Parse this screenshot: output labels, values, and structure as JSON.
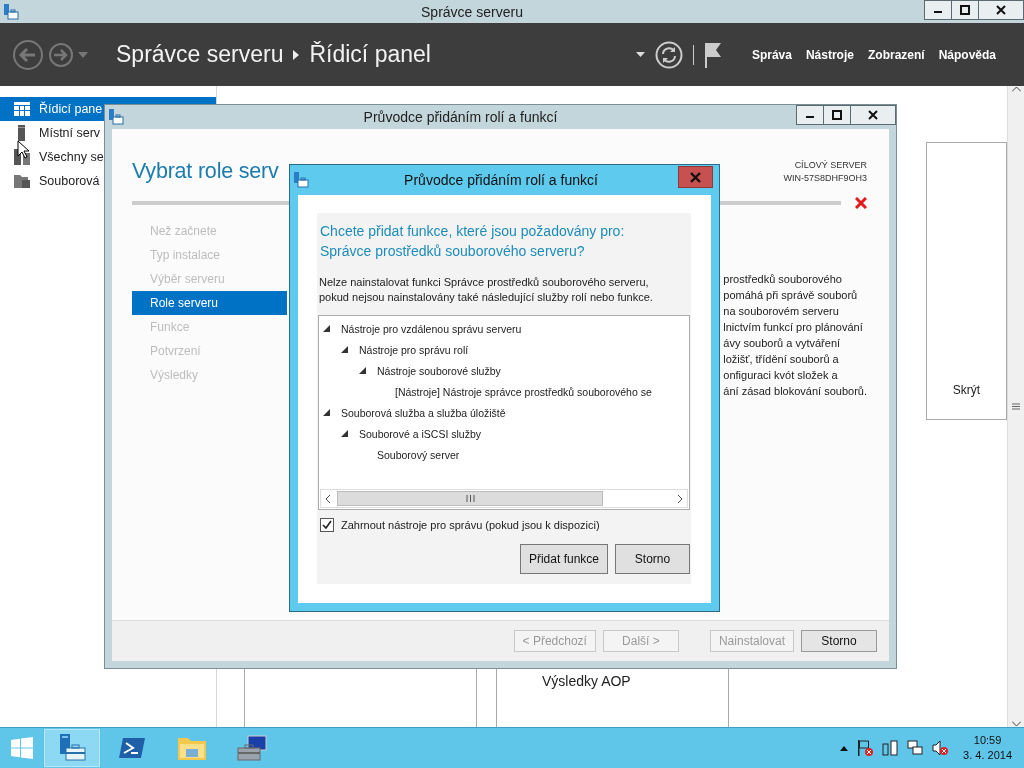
{
  "window": {
    "title": "Správce serveru",
    "breadcrumb": [
      "Správce serveru",
      "Řídicí panel"
    ],
    "menu": [
      "Správa",
      "Nástroje",
      "Zobrazení",
      "Nápověda"
    ]
  },
  "sidebar": {
    "items": [
      {
        "label": "Řídicí pane",
        "kind": "dashboard",
        "selected": true
      },
      {
        "label": "Místní serv",
        "kind": "local",
        "selected": false
      },
      {
        "label": "Všechny se",
        "kind": "all",
        "selected": false
      },
      {
        "label": "Souborová",
        "kind": "files",
        "selected": false
      }
    ]
  },
  "dashboard": {
    "hide_link": "Skrýt",
    "tile_title": "Výsledky AOP"
  },
  "wizard": {
    "title": "Průvodce přidáním rolí a funkcí",
    "heading": "Vybrat role serv",
    "target_label": "CÍLOVÝ SERVER",
    "target_server": "WIN-57S8DHF9OH3",
    "steps": [
      {
        "label": "Než začnete",
        "selected": false
      },
      {
        "label": "Typ instalace",
        "selected": false
      },
      {
        "label": "Výběr serveru",
        "selected": false
      },
      {
        "label": "Role serveru",
        "selected": true
      },
      {
        "label": "Funkce",
        "selected": false
      },
      {
        "label": "Potvrzení",
        "selected": false
      },
      {
        "label": "Výsledky",
        "selected": false
      }
    ],
    "description_lines": [
      "prostředků souborového",
      "pomáhá při správě souborů",
      "na souborovém serveru",
      "lnictvím funkcí pro plánování",
      "ávy souborů a vytváření",
      "ložišť, třídění souborů a",
      "onfiguraci kvót složek a",
      "ání zásad blokování souborů."
    ],
    "buttons": [
      {
        "label": "< Předchozí",
        "disabled": true
      },
      {
        "label": "Další >",
        "disabled": true
      },
      {
        "label": "Nainstalovat",
        "disabled": true
      },
      {
        "label": "Storno",
        "disabled": false
      }
    ]
  },
  "dialog": {
    "title": "Průvodce přidáním rolí a funkcí",
    "question": "Chcete přidat funkce, které jsou požadovány pro: Správce prostředků souborového serveru?",
    "message": "Nelze nainstalovat funkci Správce prostředků souborového serveru, pokud nejsou nainstalovány také následující služby rolí nebo funkce.",
    "tree": [
      {
        "label": "Nástroje pro vzdálenou správu serveru",
        "expanded": true,
        "children": [
          {
            "label": "Nástroje pro správu rolí",
            "expanded": true,
            "children": [
              {
                "label": "Nástroje souborové služby",
                "expanded": true,
                "children": [
                  {
                    "label": "[Nástroje] Nástroje správce prostředků souborového se"
                  }
                ]
              }
            ]
          }
        ]
      },
      {
        "label": "Souborová služba a služba úložiště",
        "expanded": true,
        "children": [
          {
            "label": "Souborové a iSCSI služby",
            "expanded": true,
            "children": [
              {
                "label": "Souborový server"
              }
            ]
          }
        ]
      }
    ],
    "include_tools": {
      "label": "Zahrnout nástroje pro správu (pokud jsou k dispozici)",
      "checked": true
    },
    "buttons": [
      {
        "label": "Přidat funkce"
      },
      {
        "label": "Storno"
      }
    ]
  },
  "taskbar": {
    "apps": [
      {
        "kind": "server-manager",
        "selected": true
      },
      {
        "kind": "powershell",
        "selected": false
      },
      {
        "kind": "explorer",
        "selected": false
      },
      {
        "kind": "toolbox",
        "selected": false
      }
    ],
    "time": "10:59",
    "date": "3. 4. 2014"
  }
}
